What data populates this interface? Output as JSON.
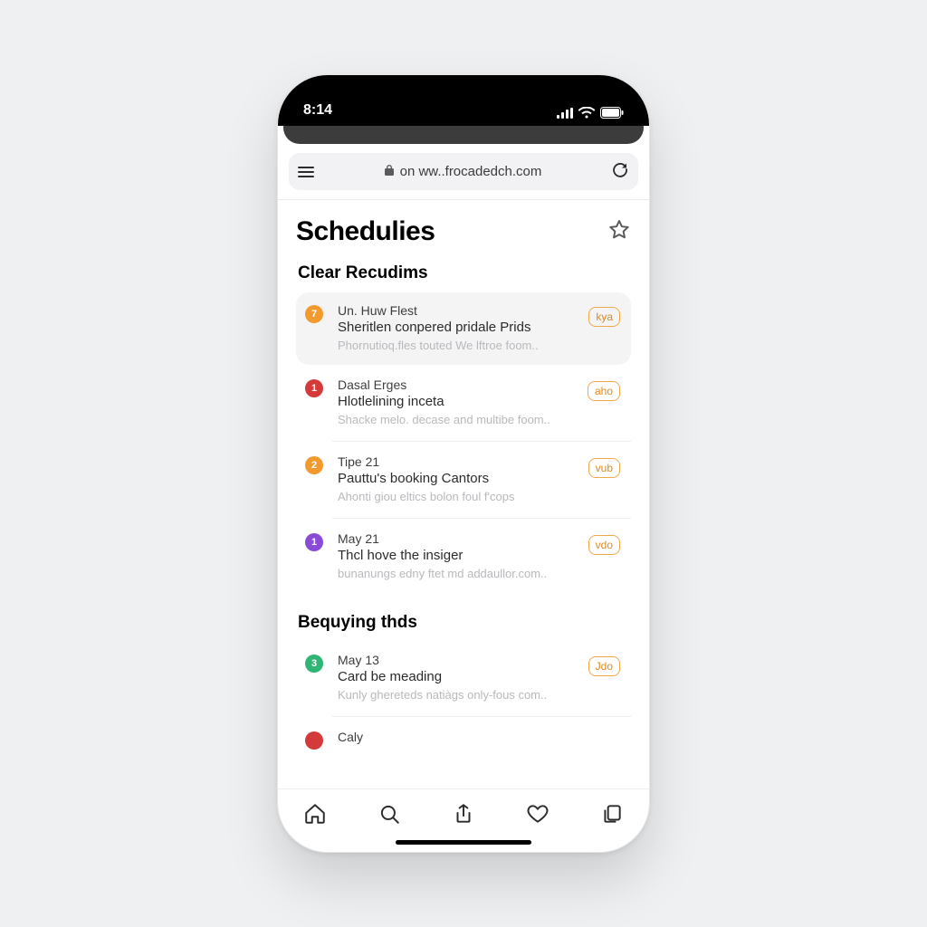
{
  "statusbar": {
    "time": "8:14"
  },
  "urlbar": {
    "url": "on ww..frocadedch.com"
  },
  "page": {
    "title": "Schedulies"
  },
  "section1": {
    "title": "Clear Recudims",
    "items": [
      {
        "badge": "7",
        "badge_color": "#f29a2e",
        "line1": "Un. Huw Flest",
        "line2": "Sheritlen conpered pridale Prids",
        "line3": "Phornutioq.fles touted We lftroe foom..",
        "tag": "kya"
      },
      {
        "badge": "1",
        "badge_color": "#d43a3a",
        "line1": "Dasal Erges",
        "line2": "Hlotlelining inceta",
        "line3": "Shacke melo. decase and multibe foom..",
        "tag": "aho"
      },
      {
        "badge": "2",
        "badge_color": "#f29a2e",
        "line1": "Tipe 21",
        "line2": "Pauttu's booking Cantors",
        "line3": "Ahonti giou eltics bolon foul f'cops",
        "tag": "vub"
      },
      {
        "badge": "1",
        "badge_color": "#8a4bd6",
        "line1": "May 21",
        "line2": "Thcl hove the insiger",
        "line3": "bunanungs edny ftet md addaullor.com..",
        "tag": "vdo"
      }
    ]
  },
  "section2": {
    "title": "Bequying thds",
    "items": [
      {
        "badge": "3",
        "badge_color": "#2fb574",
        "line1": "May 13",
        "line2": "Card be meading",
        "line3": "Kunly ghereteds natiàgs only-fous com..",
        "tag": "Jdo"
      },
      {
        "badge": "",
        "badge_color": "#d43a3a",
        "line1": "Caly",
        "line2": "",
        "line3": "",
        "tag": ""
      }
    ]
  }
}
